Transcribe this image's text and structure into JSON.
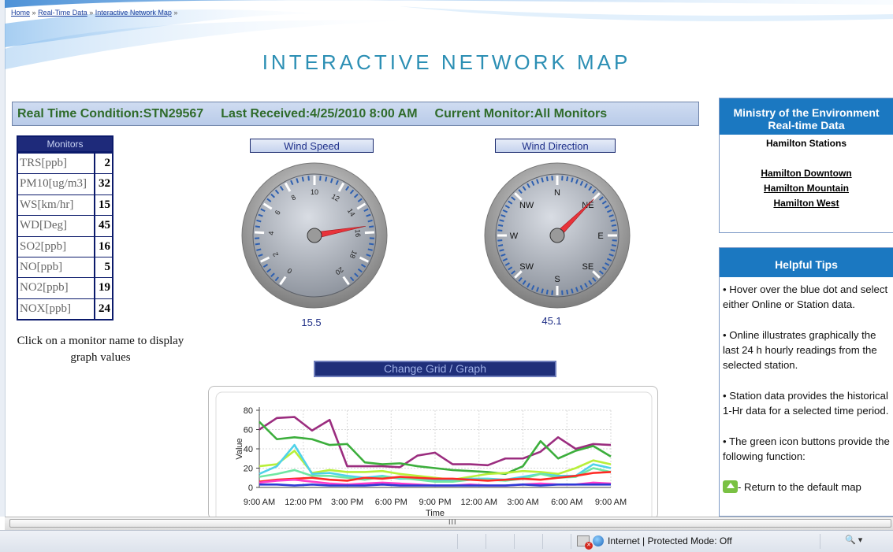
{
  "breadcrumb": {
    "items": [
      "Home",
      "Real-Time Data",
      "Interactive Network Map"
    ],
    "separator": "»"
  },
  "page_title": "INTERACTIVE NETWORK MAP",
  "status_bar": {
    "condition": "Real Time Condition:STN29567",
    "last_received": "Last Received:4/25/2010 8:00 AM",
    "current_monitor": "Current Monitor:All Monitors"
  },
  "monitors": {
    "header": "Monitors",
    "rows": [
      {
        "name": "TRS[ppb]",
        "value": "2"
      },
      {
        "name": "PM10[ug/m3]",
        "value": "32"
      },
      {
        "name": "WS[km/hr]",
        "value": "15"
      },
      {
        "name": "WD[Deg]",
        "value": "45"
      },
      {
        "name": "SO2[ppb]",
        "value": "16"
      },
      {
        "name": "NO[ppb]",
        "value": "5"
      },
      {
        "name": "NO2[ppb]",
        "value": "19"
      },
      {
        "name": "NOX[ppb]",
        "value": "24"
      }
    ]
  },
  "click_hint": "Click on a monitor name to display graph values",
  "wind_speed": {
    "label": "Wind Speed",
    "value": "15.5",
    "min": 0,
    "max": 20,
    "ticks": [
      "0",
      "2",
      "4",
      "6",
      "8",
      "10",
      "12",
      "14",
      "16",
      "18",
      "20"
    ]
  },
  "wind_direction": {
    "label": "Wind Direction",
    "value": "45.1",
    "cardinals": [
      "N",
      "NE",
      "E",
      "SE",
      "S",
      "SW",
      "W",
      "NW"
    ]
  },
  "grid_button": "Change Grid / Graph",
  "chart_data": {
    "type": "line",
    "ylabel": "Value",
    "xlabel": "Time",
    "ylim": [
      0,
      80
    ],
    "yticks": [
      "0",
      "20",
      "40",
      "60",
      "80"
    ],
    "categories": [
      "9:00 AM",
      "12:00 PM",
      "3:00 PM",
      "6:00 PM",
      "9:00 PM",
      "12:00 AM",
      "3:00 AM",
      "6:00 AM",
      "9:00 AM"
    ],
    "series": [
      {
        "color": "#9b2d7f",
        "values": [
          60,
          72,
          73,
          59,
          70,
          22,
          22,
          22,
          21,
          33,
          36,
          24,
          24,
          23,
          30,
          30,
          37,
          52,
          40,
          45,
          44
        ]
      },
      {
        "color": "#3cae3c",
        "values": [
          68,
          50,
          52,
          50,
          44,
          45,
          26,
          24,
          25,
          22,
          20,
          18,
          17,
          16,
          14,
          22,
          48,
          30,
          38,
          43,
          32
        ]
      },
      {
        "color": "#b8ef3a",
        "values": [
          22,
          24,
          38,
          15,
          18,
          16,
          16,
          17,
          14,
          12,
          10,
          8,
          11,
          14,
          15,
          17,
          16,
          14,
          20,
          28,
          24
        ]
      },
      {
        "color": "#4fd2e9",
        "values": [
          14,
          22,
          44,
          14,
          15,
          12,
          10,
          12,
          9,
          9,
          7,
          8,
          9,
          9,
          8,
          11,
          14,
          12,
          12,
          24,
          20
        ]
      },
      {
        "color": "#6fe7a2",
        "values": [
          11,
          14,
          18,
          12,
          12,
          10,
          8,
          11,
          10,
          8,
          6,
          6,
          8,
          8,
          7,
          9,
          14,
          10,
          11,
          20,
          16
        ]
      },
      {
        "color": "#ff2a24",
        "values": [
          6,
          8,
          9,
          10,
          8,
          7,
          10,
          9,
          11,
          10,
          9,
          9,
          8,
          7,
          8,
          9,
          8,
          10,
          12,
          15,
          16
        ]
      },
      {
        "color": "#ff3cc8",
        "values": [
          5,
          7,
          8,
          6,
          4,
          3,
          4,
          5,
          4,
          3,
          2,
          2,
          3,
          2,
          2,
          3,
          4,
          3,
          3,
          5,
          4
        ]
      },
      {
        "color": "#2e3bd6",
        "values": [
          3,
          3,
          2,
          3,
          2,
          2,
          2,
          3,
          2,
          2,
          2,
          2,
          2,
          2,
          2,
          3,
          2,
          3,
          3,
          3,
          3
        ]
      }
    ]
  },
  "ministry": {
    "title": "Ministry of the Environment Real-time Data",
    "stations_heading": "Hamilton Stations",
    "stations": [
      "Hamilton Downtown",
      "Hamilton Mountain",
      "Hamilton West"
    ]
  },
  "tips": {
    "title": "Helpful Tips",
    "items": [
      "• Hover over the blue dot and select either Online or Station data.",
      "• Online illustrates graphically the last 24 h hourly readings from the selected station.",
      "• Station data provides the historical 1-Hr data for a selected time period.",
      "• The green icon buttons provide the following function:"
    ],
    "icon_tip": "- Return to the default map"
  },
  "scrollbar_grip": "III",
  "ie_status": {
    "zone_text": "Internet | Protected Mode: Off",
    "zoom_icon": "zoom-icon"
  },
  "colors": {
    "accent": "#1b78c1",
    "title": "#2c8fb4",
    "status_text": "#2f6b2b",
    "navy": "#1e2a7a"
  }
}
